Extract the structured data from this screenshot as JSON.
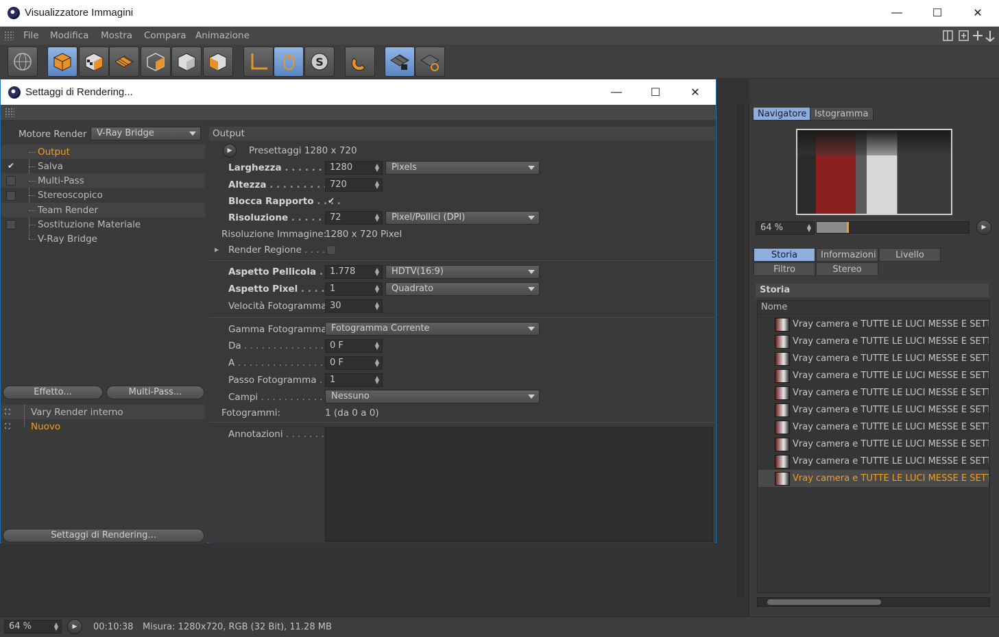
{
  "window": {
    "title": "Visualizzatore Immagini",
    "controls": {
      "minimize": "—",
      "maximize": "☐",
      "close": "✕"
    }
  },
  "menu": [
    "File",
    "Modifica",
    "Mostra",
    "Compara",
    "Animazione"
  ],
  "navigator": {
    "tabs": [
      "Navigatore",
      "Istogramma"
    ],
    "zoom": "64 %"
  },
  "history": {
    "tabs_row1": [
      "Storia",
      "Informazioni",
      "Livello"
    ],
    "tabs_row2": [
      "Filtro",
      "Stereo"
    ],
    "panel_title": "Storia",
    "column_name": "Nome",
    "items": [
      "Vray camera e TUTTE LE LUCI MESSE E SETTATI",
      "Vray camera e TUTTE LE LUCI MESSE E SETTATI",
      "Vray camera e TUTTE LE LUCI MESSE E SETTATI",
      "Vray camera e TUTTE LE LUCI MESSE E SETTATI",
      "Vray camera e TUTTE LE LUCI MESSE E SETTATI",
      "Vray camera e TUTTE LE LUCI MESSE E SETTATI",
      "Vray camera e TUTTE LE LUCI MESSE E SETTATI",
      "Vray camera e TUTTE LE LUCI MESSE E SETTATI",
      "Vray camera e TUTTE LE LUCI MESSE E SETTATI",
      "Vray camera e TUTTE LE LUCI MESSE E SETTATI"
    ]
  },
  "status": {
    "zoom": "64 %",
    "time": "00:10:38",
    "info": "Misura: 1280x720, RGB (32 Bit), 11.28 MB"
  },
  "dialog": {
    "title": "Settaggi di Rendering...",
    "engine_label": "Motore Render",
    "engine_value": "V-Ray Bridge",
    "tree": [
      "Output",
      "Salva",
      "Multi-Pass",
      "Stereoscopico",
      "Team Render",
      "Sostituzione Materiale",
      "V-Ray Bridge"
    ],
    "buttons": {
      "effect": "Effetto...",
      "multipass": "Multi-Pass...",
      "render_settings": "Settaggi di Rendering..."
    },
    "settings_list": [
      "Vary Render interno",
      "Nuovo"
    ],
    "output": {
      "header": "Output",
      "preset": "Presettaggi 1280 x 720",
      "width_label": "Larghezza",
      "width_value": "1280",
      "unit": "Pixels",
      "height_label": "Altezza",
      "height_value": "720",
      "lock_label": "Blocca Rapporto",
      "resolution_label": "Risoluzione",
      "resolution_value": "72",
      "resolution_unit": "Pixel/Pollici (DPI)",
      "image_res_label": "Risoluzione Immagine:",
      "image_res_value": "1280 x 720 Pixel",
      "region_label": "Render Regione",
      "film_aspect_label": "Aspetto Pellicola",
      "film_aspect_value": "1.778",
      "film_aspect_preset": "HDTV(16:9)",
      "pixel_aspect_label": "Aspetto Pixel",
      "pixel_aspect_value": "1",
      "pixel_aspect_preset": "Quadrato",
      "fps_label": "Velocità Fotogramma",
      "fps_value": "30",
      "frame_range_label": "Gamma Fotogramma",
      "frame_range_value": "Fotogramma Corrente",
      "from_label": "Da",
      "from_value": "0 F",
      "to_label": "A",
      "to_value": "0 F",
      "step_label": "Passo Fotogramma",
      "step_value": "1",
      "fields_label": "Campi",
      "fields_value": "Nessuno",
      "frames_label": "Fotogrammi:",
      "frames_value": "1 (da 0 a 0)",
      "notes_label": "Annotazioni"
    }
  }
}
